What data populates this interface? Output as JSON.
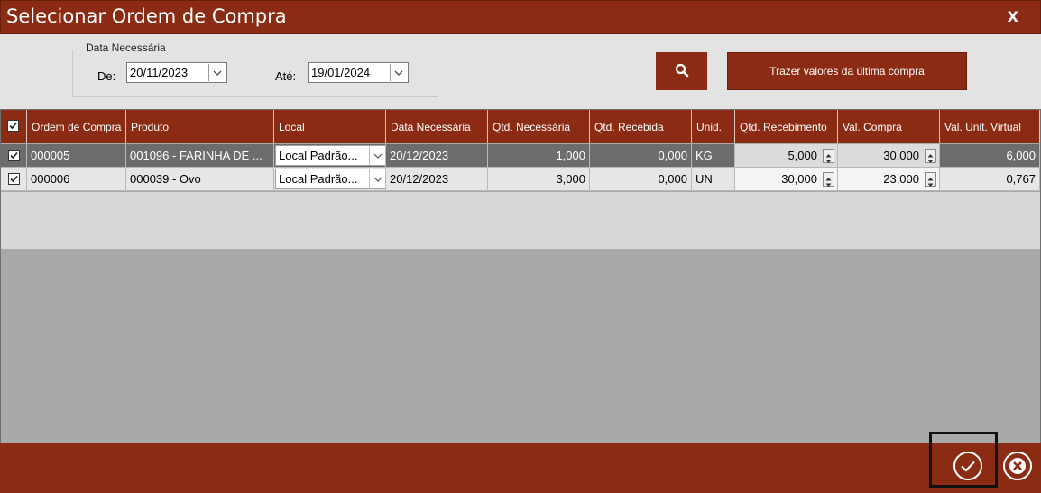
{
  "window": {
    "title": "Selecionar Ordem de Compra",
    "close_label": "X"
  },
  "filter": {
    "legend": "Data Necessária",
    "from_label": "De:",
    "from_value": "20/11/2023",
    "to_label": "Até:",
    "to_value": "19/01/2024"
  },
  "actions": {
    "fetch_last_purchase_label": "Trazer valores da última compra"
  },
  "grid": {
    "headers": {
      "ordem": "Ordem de Compra",
      "produto": "Produto",
      "local": "Local",
      "data": "Data Necessária",
      "qtd_nec": "Qtd. Necessária",
      "qtd_rec": "Qtd. Recebida",
      "unid": "Unid.",
      "qtd_receb": "Qtd. Recebimento",
      "val_compra": "Val. Compra",
      "val_unit": "Val. Unit. Virtual"
    },
    "rows": [
      {
        "checked": true,
        "ordem": "000005",
        "produto": "001096 - FARINHA DE ...",
        "local": "Local Padrão...",
        "data": "20/12/2023",
        "qtd_nec": "1,000",
        "qtd_rec": "0,000",
        "unid": "KG",
        "qtd_receb": "5,000",
        "val_compra": "30,000",
        "val_unit": "6,000"
      },
      {
        "checked": true,
        "ordem": "000006",
        "produto": "000039 - Ovo",
        "local": "Local Padrão...",
        "data": "20/12/2023",
        "qtd_nec": "3,000",
        "qtd_rec": "0,000",
        "unid": "UN",
        "qtd_receb": "30,000",
        "val_compra": "23,000",
        "val_unit": "0,767"
      }
    ]
  },
  "colors": {
    "brand": "#8b2b14",
    "selected_row": "#6d6d6d",
    "grid_bg": "#a9a9a9"
  },
  "icons": {
    "search": "search-icon",
    "confirm": "check-circle-icon",
    "cancel": "close-circle-icon"
  }
}
